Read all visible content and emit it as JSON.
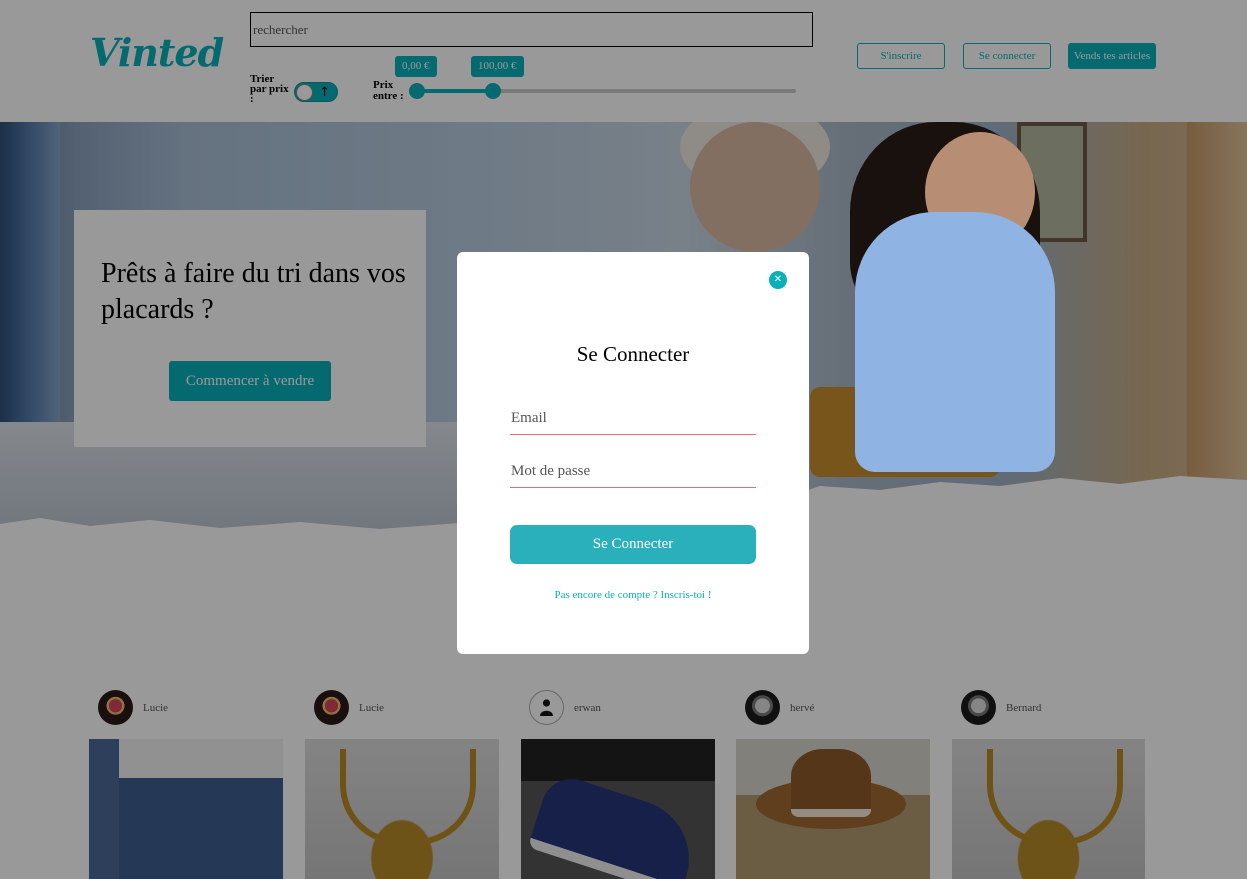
{
  "header": {
    "logo": "Vinted",
    "search": {
      "placeholder": "rechercher",
      "value": ""
    },
    "sort": {
      "label": "Trier par prix :",
      "toggle_state": "ascending",
      "arrow": "↑"
    },
    "price_filter": {
      "label": "Prix entre :",
      "min_label": "0,00 €",
      "max_label": "100,00 €",
      "min": 0,
      "max": 100,
      "range_fraction": [
        0,
        0.2
      ]
    },
    "buttons": {
      "signup": "S'inscrire",
      "login": "Se connecter",
      "sell": "Vends tes articles"
    }
  },
  "hero": {
    "title": "Prêts à faire du tri dans vos placards ?",
    "cta": "Commencer à vendre"
  },
  "feed": {
    "items": [
      {
        "username": "Lucie",
        "avatar": "photo-avatar",
        "image": "denim-skirt-photo"
      },
      {
        "username": "Lucie",
        "avatar": "photo-avatar",
        "image": "samurai-helmet-photo"
      },
      {
        "username": "erwan",
        "avatar": "default-person-icon",
        "image": "sneakers-photo"
      },
      {
        "username": "hervé",
        "avatar": "photo-avatar",
        "image": "brown-hat-photo"
      },
      {
        "username": "Bernard",
        "avatar": "photo-avatar",
        "image": "samurai-helmet-photo"
      }
    ]
  },
  "modal": {
    "title": "Se Connecter",
    "email_placeholder": "Email",
    "password_placeholder": "Mot de passe",
    "submit": "Se Connecter",
    "signup_link": "Pas encore de compte ? Inscris-toi !",
    "close_icon": "close-icon"
  },
  "colors": {
    "accent": "#09b1ba",
    "field_underline": "#e96c7e",
    "overlay": "rgba(0,0,0,0.4)"
  }
}
